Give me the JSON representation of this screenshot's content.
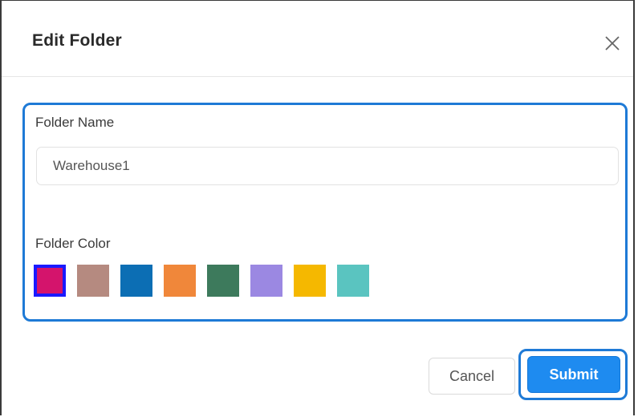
{
  "dialog": {
    "title": "Edit Folder",
    "close_icon": "close-icon"
  },
  "form": {
    "name_label": "Folder Name",
    "name_value": "Warehouse1",
    "color_label": "Folder Color",
    "colors": [
      {
        "hex": "#d4146c",
        "selected": true
      },
      {
        "hex": "#b58a80",
        "selected": false
      },
      {
        "hex": "#0c6eb4",
        "selected": false
      },
      {
        "hex": "#f0873a",
        "selected": false
      },
      {
        "hex": "#3d7a5c",
        "selected": false
      },
      {
        "hex": "#9b88e2",
        "selected": false
      },
      {
        "hex": "#f5b800",
        "selected": false
      },
      {
        "hex": "#5ac4c0",
        "selected": false
      }
    ],
    "selected_border_color": "#1a1aff"
  },
  "actions": {
    "cancel_label": "Cancel",
    "submit_label": "Submit"
  },
  "accent": "#1e7ad6"
}
